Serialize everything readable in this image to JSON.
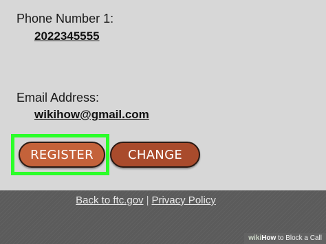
{
  "fields": {
    "phone_label": "Phone Number 1:",
    "phone_value": "2022345555",
    "email_label": "Email Address:",
    "email_value": "wikihow@gmail.com"
  },
  "buttons": {
    "register": "REGISTER",
    "change": "CHANGE"
  },
  "footer": {
    "back_link": "Back to ftc.gov",
    "separator": "|",
    "privacy_link": "Privacy Policy"
  },
  "watermark": {
    "wiki": "wiki",
    "how": "How",
    "title": " to Block a Call"
  },
  "colors": {
    "register_button": "#c4623a",
    "change_button": "#a94b2c",
    "highlight_box": "#2bff29",
    "page_background": "#d7d7d7",
    "footer_background": "#5b5b5b"
  }
}
